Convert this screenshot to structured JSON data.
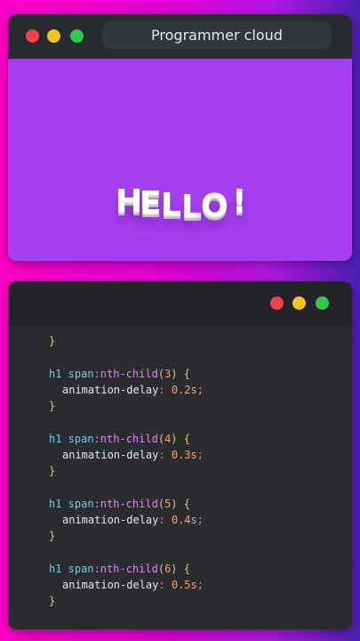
{
  "preview_window": {
    "title": "Programmer cloud",
    "hello_letters": [
      "H",
      "E",
      "L",
      "L",
      "O",
      "!"
    ]
  },
  "code": {
    "lines": [
      {
        "close": "}"
      },
      {
        "selector": "h1 span",
        "pseudo": ":nth-child",
        "open_paren": "(",
        "arg": "3",
        "close_paren": ")",
        "open_brace": "{"
      },
      {
        "property": "animation-delay",
        "colon": ":",
        "value": "0.2s",
        "semicolon": ";"
      },
      {
        "close": "}"
      },
      {
        "selector": "h1 span",
        "pseudo": ":nth-child",
        "open_paren": "(",
        "arg": "4",
        "close_paren": ")",
        "open_brace": "{"
      },
      {
        "property": "animation-delay",
        "colon": ":",
        "value": "0.3s",
        "semicolon": ";"
      },
      {
        "close": "}"
      },
      {
        "selector": "h1 span",
        "pseudo": ":nth-child",
        "open_paren": "(",
        "arg": "5",
        "close_paren": ")",
        "open_brace": "{"
      },
      {
        "property": "animation-delay",
        "colon": ":",
        "value": "0.4s",
        "semicolon": ";"
      },
      {
        "close": "}"
      },
      {
        "selector": "h1 span",
        "pseudo": ":nth-child",
        "open_paren": "(",
        "arg": "6",
        "close_paren": ")",
        "open_brace": "{"
      },
      {
        "property": "animation-delay",
        "colon": ":",
        "value": "0.5s",
        "semicolon": ";"
      },
      {
        "close": "}"
      }
    ]
  },
  "colors": {
    "close_dot": "#f04343",
    "minimize_dot": "#f4c320",
    "maximize_dot": "#33c84a",
    "preview_bg": "#a63ff2"
  }
}
